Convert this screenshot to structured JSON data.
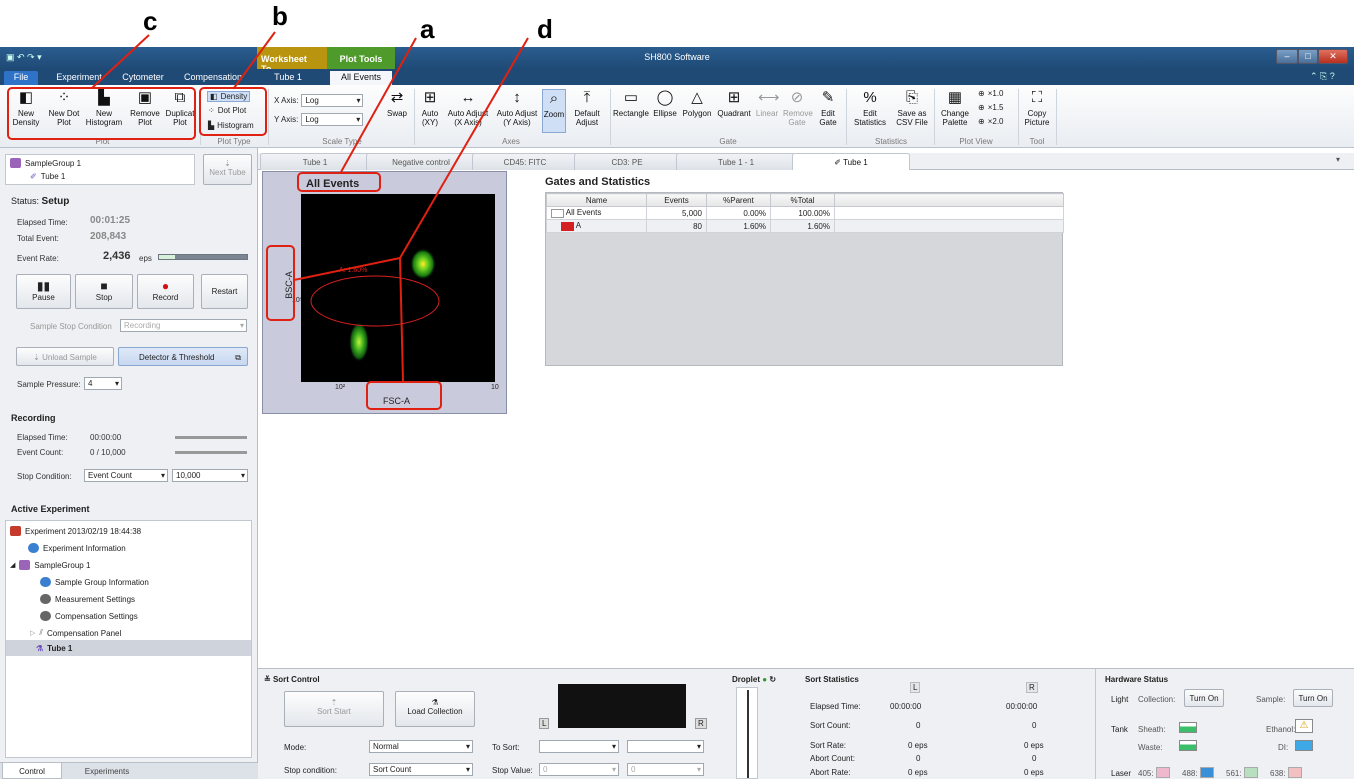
{
  "annotations": {
    "a": "a",
    "b": "b",
    "c": "c",
    "d": "d"
  },
  "titlebar": {
    "app_title": "SH800 Software",
    "context_worksheet": "Worksheet To...",
    "context_plot": "Plot Tools",
    "qat": "▣ ↶ ↷ ▾"
  },
  "ribbon_tabs": [
    "File",
    "Experiment",
    "Cytometer",
    "Compensation",
    "Tube 1",
    "All Events"
  ],
  "ribbon": {
    "plot_group": {
      "label": "Plot",
      "new_density": "New Density",
      "new_dot": "New Dot Plot",
      "new_hist": "New Histogram",
      "remove": "Remove Plot",
      "duplicate": "Duplicat Plot"
    },
    "plot_type_group": {
      "label": "Plot Type",
      "density": "Density",
      "dot": "Dot Plot",
      "hist": "Histogram"
    },
    "scale_group": {
      "label": "Scale Type",
      "x_axis": "X Axis:",
      "x_val": "Log",
      "y_axis": "Y Axis:",
      "y_val": "Log",
      "swap": "Swap"
    },
    "axes_group": {
      "label": "Axes",
      "auto": "Auto (XY)",
      "auto_x": "Auto Adjust (X Axis)",
      "auto_y": "Auto Adjust (Y Axis)",
      "zoom": "Zoom",
      "default": "Default Adjust"
    },
    "gate_group": {
      "label": "Gate",
      "rect": "Rectangle",
      "ellipse": "Ellipse",
      "polygon": "Polygon",
      "quadrant": "Quadrant",
      "linear": "Linear",
      "remove": "Remove Gate",
      "edit": "Edit Gate"
    },
    "stats_group": {
      "label": "Statistics",
      "edit": "Edit Statistics",
      "save": "Save as CSV File"
    },
    "view_group": {
      "label": "Plot View",
      "palette": "Change Palette",
      "x10": "×1.0",
      "x15": "×1.5",
      "x20": "×2.0"
    },
    "tool_group": {
      "label": "Tool",
      "copy": "Copy Picture"
    }
  },
  "left": {
    "sample_group": "SampleGroup 1",
    "tube": "Tube 1",
    "next_tube": "Next Tube",
    "status_label": "Status:",
    "status_value": "Setup",
    "elapsed_label": "Elapsed Time:",
    "elapsed_value": "00:01:25",
    "total_label": "Total Event:",
    "total_value": "208,843",
    "rate_label": "Event Rate:",
    "rate_value": "2,436",
    "rate_unit": "eps",
    "rate_fraction": 0.18,
    "pause": "Pause",
    "stop": "Stop",
    "record": "Record",
    "restart": "Restart",
    "stop_cond_label": "Sample Stop Condition",
    "stop_cond_value": "Recording",
    "unload": "Unload Sample",
    "detector": "Detector & Threshold",
    "pressure_label": "Sample Pressure:",
    "pressure_value": "4",
    "recording_title": "Recording",
    "rec_elapsed_label": "Elapsed Time:",
    "rec_elapsed_value": "00:00:00",
    "rec_count_label": "Event Count:",
    "rec_count_value": "0 / 10,000",
    "rec_stop_label": "Stop Condition:",
    "rec_stop_value": "Event Count",
    "rec_stop_num": "10,000",
    "active_title": "Active Experiment",
    "tree": [
      "Experiment 2013/02/19 18:44:38",
      "Experiment Information",
      "SampleGroup 1",
      "Sample Group Information",
      "Measurement Settings",
      "Compensation Settings",
      "Compensation Panel",
      "Tube 1"
    ],
    "bottom_tabs": [
      "Control",
      "Experiments"
    ]
  },
  "doc_tabs": [
    "Tube 1",
    "Negative control",
    "CD45: FITC",
    "CD3: PE",
    "Tube 1 - 1",
    "Tube 1"
  ],
  "plot": {
    "title": "All Events",
    "ylabel": "BSC-A",
    "xlabel": "FSC-A",
    "gate_label": "A: 1.60%",
    "y_tick": "10⁵",
    "x_tick_left": "10²",
    "x_tick_right": "10"
  },
  "stats": {
    "title": "Gates and Statistics",
    "headers": [
      "Name",
      "Events",
      "%Parent",
      "%Total"
    ],
    "rows": [
      {
        "name": "All Events",
        "events": "5,000",
        "parent": "0.00%",
        "total": "100.00%",
        "color": "#ffffff"
      },
      {
        "name": "A",
        "events": "80",
        "parent": "1.60%",
        "total": "1.60%",
        "color": "#d42020"
      }
    ]
  },
  "sort": {
    "title": "Sort Control",
    "sort_start": "Sort Start",
    "load_collection": "Load Collection",
    "mode_label": "Mode:",
    "mode_value": "Normal",
    "stop_label": "Stop condition:",
    "stop_value": "Sort Count",
    "to_sort": "To Sort:",
    "stop_value_label": "Stop Value:",
    "stop_value_num": "0",
    "L": "L",
    "R": "R",
    "droplet": "Droplet"
  },
  "sort_stats": {
    "title": "Sort Statistics",
    "L": "L",
    "R": "R",
    "rows": [
      {
        "label": "Elapsed Time:",
        "l": "00:00:00",
        "r": "00:00:00"
      },
      {
        "label": "Sort Count:",
        "l": "0",
        "r": "0"
      },
      {
        "label": "Sort Rate:",
        "l": "0 eps",
        "r": "0 eps"
      },
      {
        "label": "Abort Count:",
        "l": "0",
        "r": "0"
      },
      {
        "label": "Abort Rate:",
        "l": "0 eps",
        "r": "0 eps"
      }
    ]
  },
  "hardware": {
    "title": "Hardware Status",
    "light": "Light",
    "collection": "Collection:",
    "turn_on_1": "Turn On",
    "sample": "Sample:",
    "turn_on_2": "Turn On",
    "tank": "Tank",
    "sheath": "Sheath:",
    "ethanol": "Ethanol:",
    "waste": "Waste:",
    "di": "DI:",
    "laser": "Laser",
    "l405": "405:",
    "l488": "488:",
    "l561": "561:",
    "l638": "638:"
  }
}
